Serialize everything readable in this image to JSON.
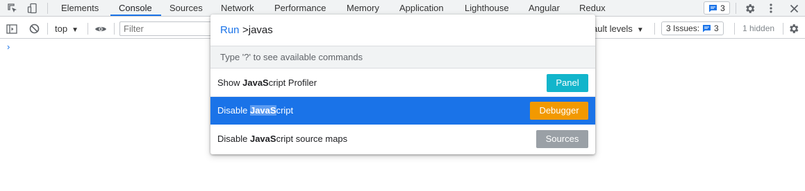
{
  "tabs": {
    "items": [
      "Elements",
      "Console",
      "Sources",
      "Network",
      "Performance",
      "Memory",
      "Application",
      "Lighthouse",
      "Angular",
      "Redux"
    ],
    "active": "Console",
    "messages_count": "3"
  },
  "toolbar": {
    "context": "top",
    "filter_placeholder": "Filter",
    "levels_label": "ault levels",
    "issues_label": "3 Issues:",
    "issues_count": "3",
    "hidden_label": "1 hidden"
  },
  "console": {
    "prompt": "›"
  },
  "command_menu": {
    "prefix": "Run",
    "query": ">javas",
    "hint": "Type '?' to see available commands",
    "items": [
      {
        "before": "Show ",
        "match": "JavaS",
        "after": "cript Profiler",
        "tag": "Panel",
        "tag_color": "#12b5cb",
        "selected": false
      },
      {
        "before": "Disable ",
        "match": "JavaS",
        "after": "cript",
        "tag": "Debugger",
        "tag_color": "#f29900",
        "selected": true
      },
      {
        "before": "Disable ",
        "match": "JavaS",
        "after": "cript source maps",
        "tag": "Sources",
        "tag_color": "#9aa0a6",
        "selected": false
      }
    ]
  },
  "colors": {
    "accent": "#1a73e8",
    "panel_tag": "#12b5cb",
    "debugger_tag": "#f29900",
    "sources_tag": "#9aa0a6"
  }
}
